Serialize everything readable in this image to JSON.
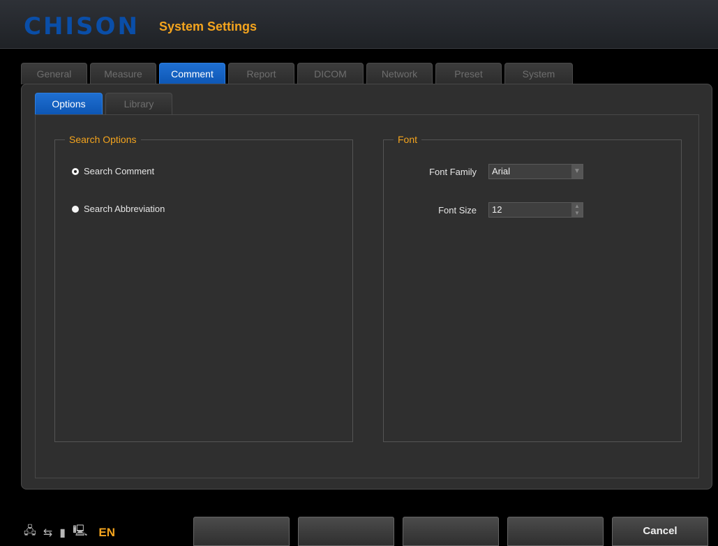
{
  "header": {
    "logo": "CHISON",
    "title": "System Settings"
  },
  "tabs": [
    "General",
    "Measure",
    "Comment",
    "Report",
    "DICOM",
    "Network",
    "Preset",
    "System"
  ],
  "active_tab": "Comment",
  "subtabs": [
    "Options",
    "Library"
  ],
  "active_subtab": "Options",
  "search_options": {
    "title": "Search Options",
    "option_comment": "Search Comment",
    "option_abbreviation": "Search Abbreviation",
    "selected": "Search Comment"
  },
  "font": {
    "title": "Font",
    "family_label": "Font Family",
    "family_value": "Arial",
    "size_label": "Font Size",
    "size_value": "12"
  },
  "status": {
    "language": "EN"
  },
  "softkeys": [
    "",
    "",
    "",
    "",
    "Cancel"
  ]
}
